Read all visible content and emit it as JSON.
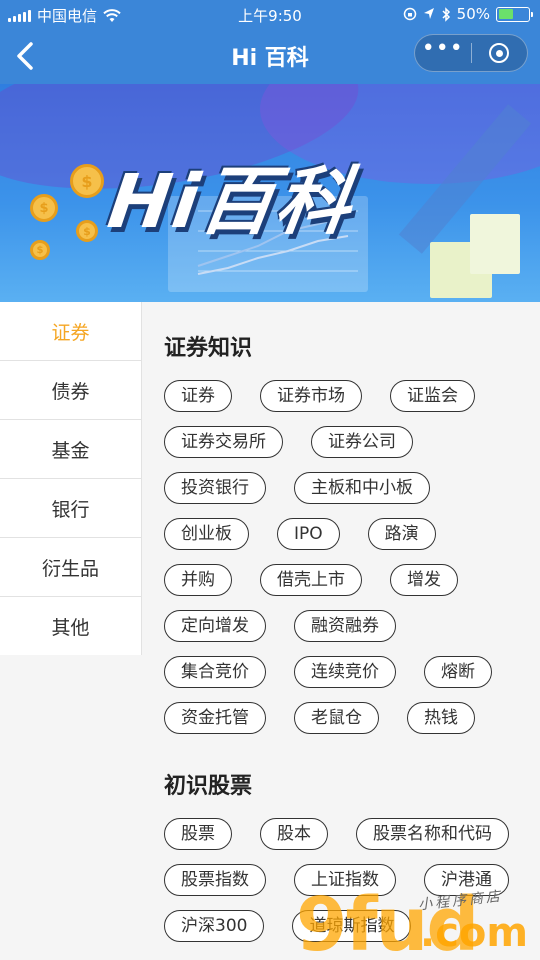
{
  "status_bar": {
    "carrier": "中国电信",
    "time": "上午9:50",
    "battery_percent": "50%",
    "battery_level": 0.5,
    "icons": [
      "signal-icon",
      "wifi-icon",
      "orientation-lock-icon",
      "location-icon",
      "bluetooth-icon",
      "battery-icon"
    ]
  },
  "nav": {
    "title": "Hi 百科",
    "back_icon": "back-chevron-icon",
    "more_label": "•••",
    "close_icon": "target-close-icon"
  },
  "banner": {
    "title": "Hi百科"
  },
  "sidebar": {
    "items": [
      {
        "label": "证券",
        "active": true
      },
      {
        "label": "债券",
        "active": false
      },
      {
        "label": "基金",
        "active": false
      },
      {
        "label": "银行",
        "active": false
      },
      {
        "label": "衍生品",
        "active": false
      },
      {
        "label": "其他",
        "active": false
      }
    ]
  },
  "sections": [
    {
      "title": "证券知识",
      "tags": [
        "证券",
        "证券市场",
        "证监会",
        "证券交易所",
        "证券公司",
        "投资银行",
        "主板和中小板",
        "创业板",
        "IPO",
        "路演",
        "并购",
        "借壳上市",
        "增发",
        "定向增发",
        "融资融券",
        "集合竞价",
        "连续竞价",
        "熔断",
        "资金托管",
        "老鼠仓",
        "热钱"
      ]
    },
    {
      "title": "初识股票",
      "tags": [
        "股票",
        "股本",
        "股票名称和代码",
        "股票指数",
        "上证指数",
        "沪港通",
        "沪深300",
        "道琼斯指数"
      ]
    }
  ],
  "watermark": {
    "brand": "9fud",
    "suffix": ".com",
    "subtitle": "小程序商店"
  },
  "colors": {
    "nav_blue": "#3b86d8",
    "active_orange": "#f5a623",
    "content_bg": "#f5f5f5"
  }
}
